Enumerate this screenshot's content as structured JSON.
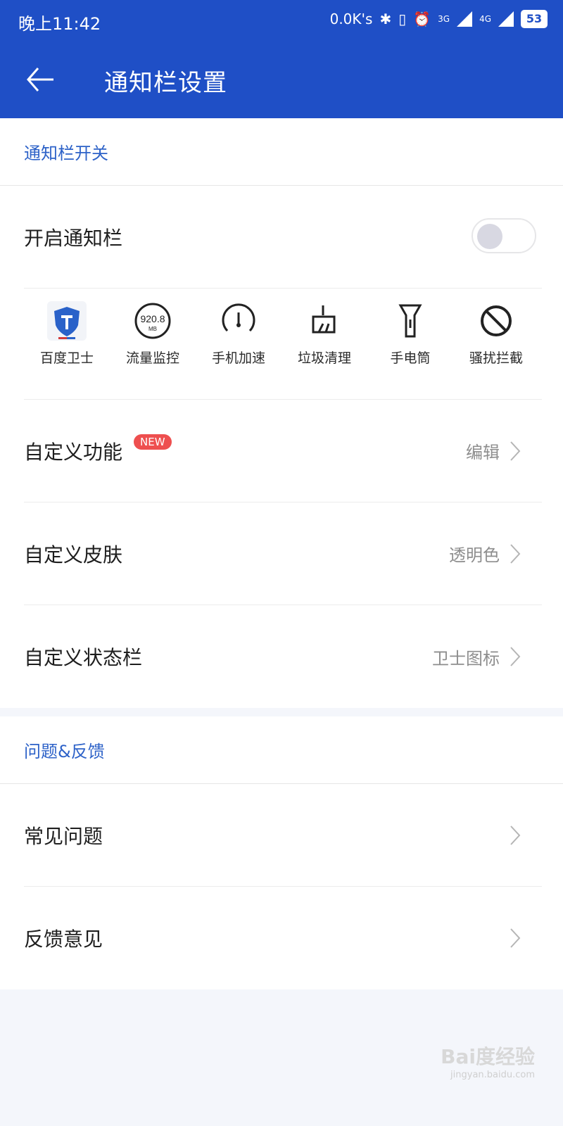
{
  "status_bar": {
    "time": "晚上11:42",
    "net_speed": "0.0K's",
    "sig1": "3G",
    "sig2": "4G",
    "battery": "53"
  },
  "header": {
    "title": "通知栏设置"
  },
  "section_switch": {
    "title": "通知栏开关",
    "enable_label": "开启通知栏",
    "enable_on": false,
    "shortcuts": [
      {
        "label": "百度卫士",
        "icon": "shield-app-icon"
      },
      {
        "label": "流量监控",
        "icon": "data-usage-icon",
        "value": "920.8",
        "unit": "MB"
      },
      {
        "label": "手机加速",
        "icon": "speedometer-icon"
      },
      {
        "label": "垃圾清理",
        "icon": "broom-icon"
      },
      {
        "label": "手电筒",
        "icon": "flashlight-icon"
      },
      {
        "label": "骚扰拦截",
        "icon": "block-icon"
      }
    ],
    "custom_function": {
      "label": "自定义功能",
      "badge": "NEW",
      "value": "编辑"
    },
    "custom_skin": {
      "label": "自定义皮肤",
      "value": "透明色"
    },
    "custom_statusbar": {
      "label": "自定义状态栏",
      "value": "卫士图标"
    }
  },
  "section_feedback": {
    "title": "问题&反馈",
    "faq": {
      "label": "常见问题"
    },
    "feedback": {
      "label": "反馈意见"
    }
  },
  "watermark": {
    "brand": "Bai度经验",
    "url": "jingyan.baidu.com"
  },
  "colors": {
    "accent": "#1f4fc6",
    "section_title": "#2d62c8",
    "badge": "#ee4f4f"
  }
}
